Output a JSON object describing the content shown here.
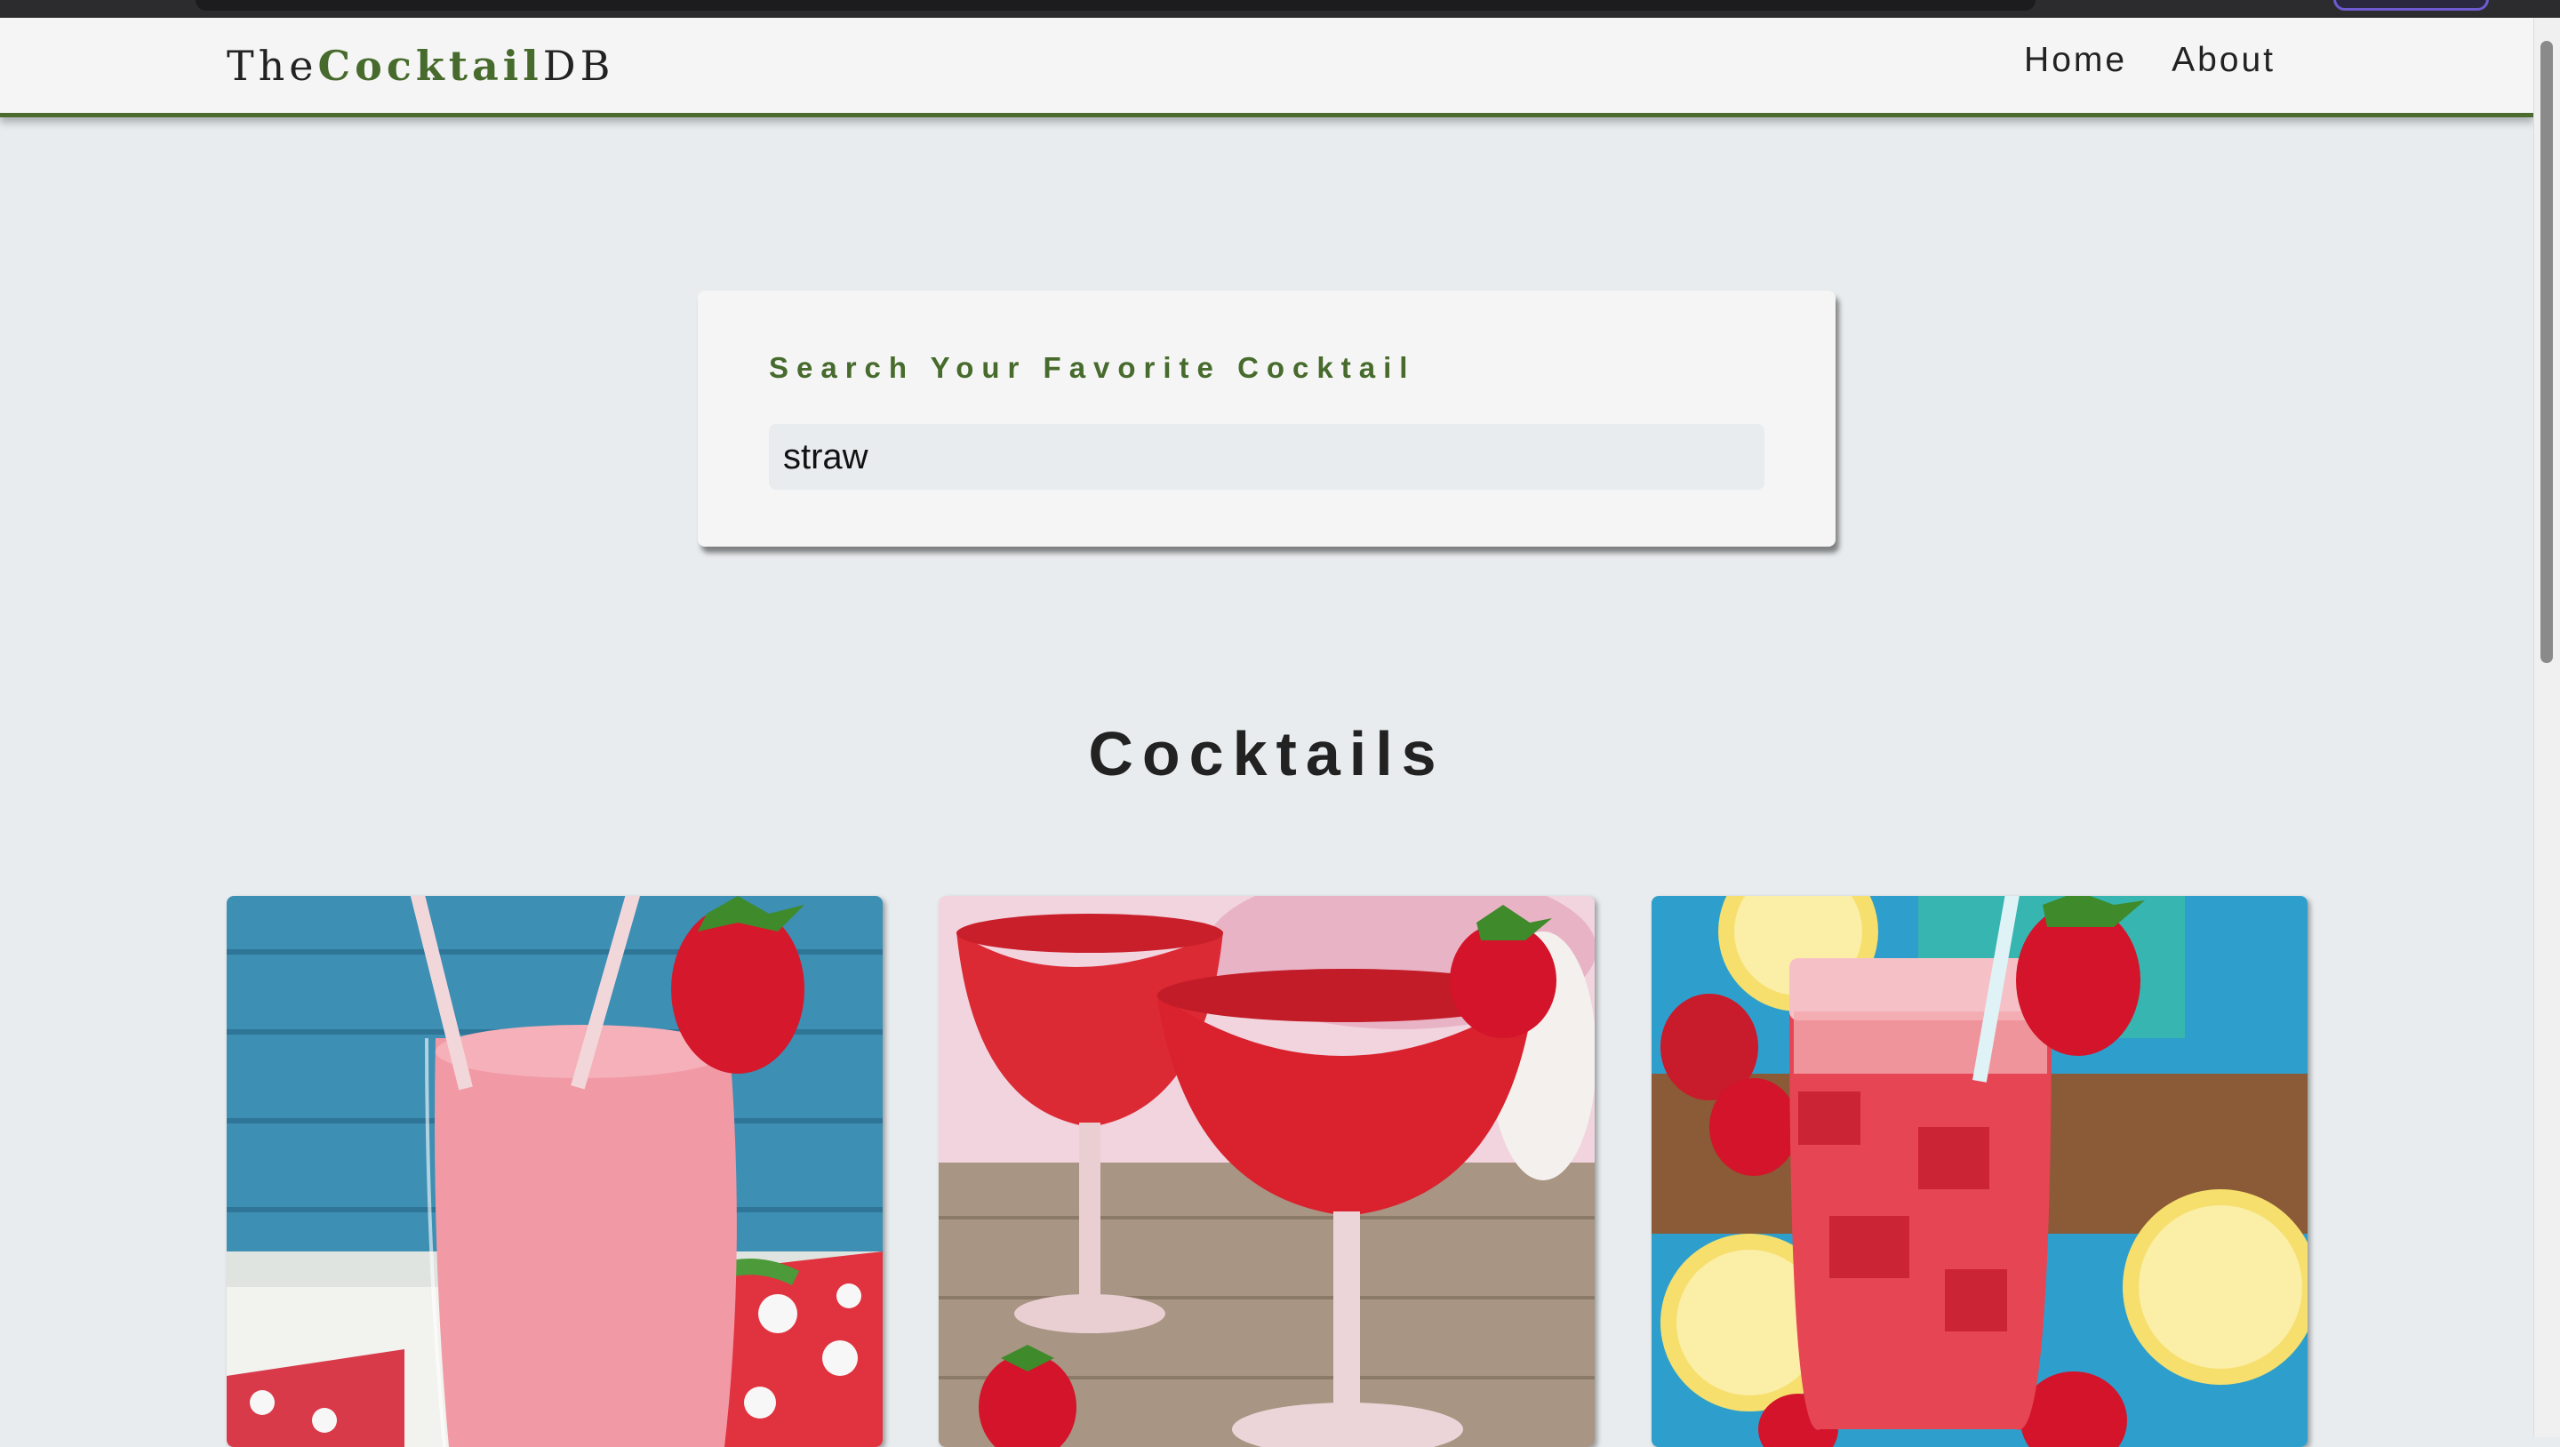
{
  "brand": {
    "prefix": "The",
    "accent": "Cocktail",
    "suffix": "DB"
  },
  "nav": {
    "home": "Home",
    "about": "About"
  },
  "search": {
    "label": "Search Your Favorite Cocktail",
    "value": "straw"
  },
  "section": {
    "title": "Cocktails"
  },
  "colors": {
    "accent": "#476b2c",
    "background": "#e8ecee",
    "card": "#f5f5f5"
  },
  "cocktails": [
    {
      "image": "strawberry-smoothie-image"
    },
    {
      "image": "strawberry-daiquiri-image"
    },
    {
      "image": "strawberry-lemonade-image"
    }
  ]
}
